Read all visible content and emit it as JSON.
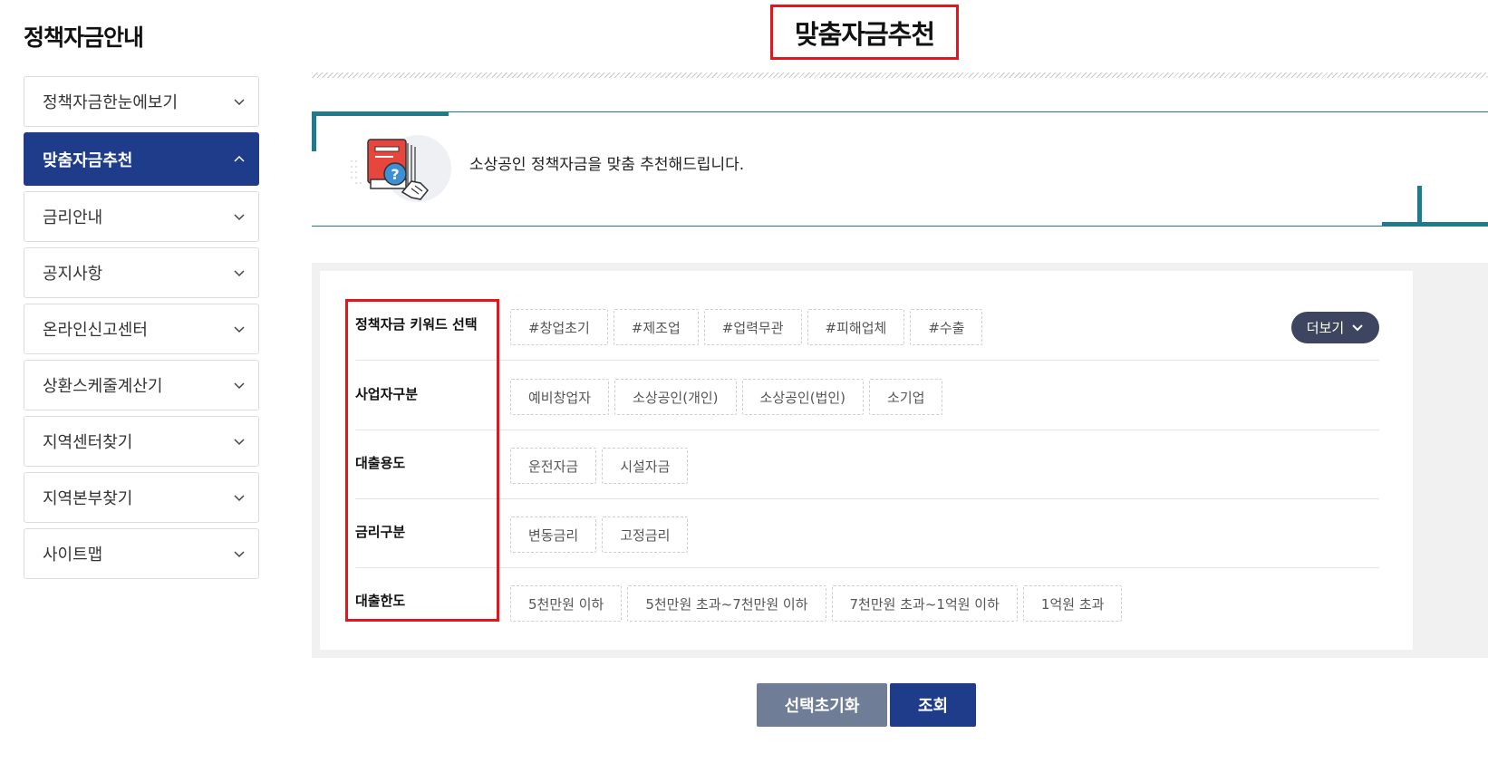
{
  "sidebar": {
    "title": "정책자금안내",
    "items": [
      {
        "label": "정책자금한눈에보기",
        "active": false
      },
      {
        "label": "맞춤자금추천",
        "active": true
      },
      {
        "label": "금리안내",
        "active": false
      },
      {
        "label": "공지사항",
        "active": false
      },
      {
        "label": "온라인신고센터",
        "active": false
      },
      {
        "label": "상환스케줄계산기",
        "active": false
      },
      {
        "label": "지역센터찾기",
        "active": false
      },
      {
        "label": "지역본부찾기",
        "active": false
      },
      {
        "label": "사이트맵",
        "active": false
      }
    ]
  },
  "page": {
    "title": "맞춤자금추천"
  },
  "banner": {
    "icon": "book-question-handshake-icon",
    "text": "소상공인 정책자금을 맞춤 추천해드립니다."
  },
  "filters": {
    "more_label": "더보기",
    "rows": [
      {
        "label": "정책자금 키워드 선택",
        "options": [
          "#창업초기",
          "#제조업",
          "#업력무관",
          "#피해업체",
          "#수출"
        ]
      },
      {
        "label": "사업자구분",
        "options": [
          "예비창업자",
          "소상공인(개인)",
          "소상공인(법인)",
          "소기업"
        ]
      },
      {
        "label": "대출용도",
        "options": [
          "운전자금",
          "시설자금"
        ]
      },
      {
        "label": "금리구분",
        "options": [
          "변동금리",
          "고정금리"
        ]
      },
      {
        "label": "대출한도",
        "options": [
          "5천만원 이하",
          "5천만원 초과~7천만원 이하",
          "7천만원 초과~1억원 이하",
          "1억원 초과"
        ]
      }
    ]
  },
  "actions": {
    "reset_label": "선택초기화",
    "search_label": "조회"
  },
  "colors": {
    "primary": "#1e3c8a",
    "teal": "#1f7a8c",
    "highlight": "#e8141b",
    "secondary_button": "#6f7d96",
    "more_button": "#3d4560"
  }
}
